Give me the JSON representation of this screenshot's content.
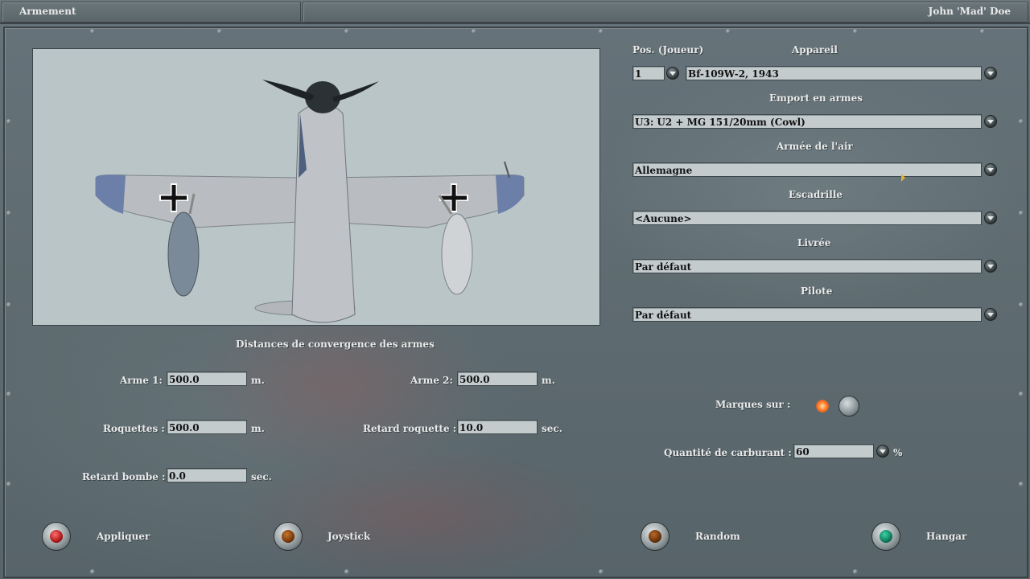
{
  "window": {
    "title": "Armement",
    "user": "John 'Mad' Doe"
  },
  "aircraft": {
    "pos_label": "Pos. (Joueur)",
    "pos_value": "1",
    "appareil_label": "Appareil",
    "appareil_value": "Bf-109W-2, 1943",
    "emport_label": "Emport en armes",
    "emport_value": "U3: U2 + MG 151/20mm (Cowl)",
    "armee_label": "Armée de l'air",
    "armee_value": "Allemagne",
    "escadrille_label": "Escadrille",
    "escadrille_value": "<Aucune>",
    "livree_label": "Livrée",
    "livree_value": "Par défaut",
    "pilote_label": "Pilote",
    "pilote_value": "Par défaut"
  },
  "convergence": {
    "title": "Distances de convergence des armes",
    "arme1_label": "Arme 1:",
    "arme1_value": "500.0",
    "arme1_unit": "m.",
    "arme2_label": "Arme 2:",
    "arme2_value": "500.0",
    "arme2_unit": "m.",
    "roquettes_label": "Roquettes :",
    "roquettes_value": "500.0",
    "roquettes_unit": "m.",
    "retard_roquette_label": "Retard roquette :",
    "retard_roquette_value": "10.0",
    "retard_roquette_unit": "sec.",
    "retard_bombe_label": "Retard bombe :",
    "retard_bombe_value": "0.0",
    "retard_bombe_unit": "sec."
  },
  "options": {
    "marques_label": "Marques sur :",
    "carburant_label": "Quantité de carburant :",
    "carburant_value": "60",
    "carburant_unit": "%"
  },
  "buttons": {
    "appliquer": "Appliquer",
    "joystick": "Joystick",
    "random": "Random",
    "hangar": "Hangar"
  },
  "colors": {
    "appliquer_core": "#b01818",
    "joystick_core": "#7a3a0a",
    "random_core": "#6a3308",
    "hangar_core": "#0f7a5a"
  }
}
